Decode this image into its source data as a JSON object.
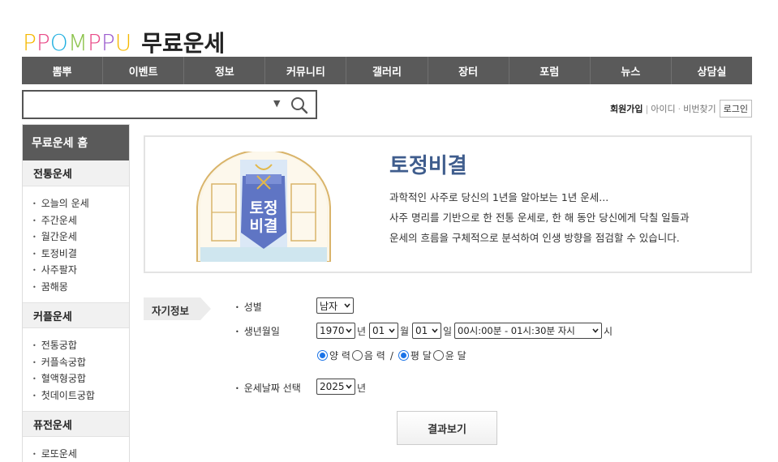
{
  "header": {
    "logo_letters": [
      "P",
      "P",
      "O",
      "M",
      "P",
      "P",
      "U"
    ],
    "logo_colors": [
      "#f5b800",
      "#e94c89",
      "#22b0e0",
      "#8bc34a",
      "#e94c89",
      "#9c5ccf",
      "#f5b800"
    ],
    "title": "무료운세"
  },
  "gnb": [
    "뽐뿌",
    "이벤트",
    "정보",
    "커뮤니티",
    "갤러리",
    "장터",
    "포럼",
    "뉴스",
    "상담실"
  ],
  "search": {
    "value": "",
    "arrow": "▼"
  },
  "member": {
    "join": "회원가입",
    "id": "아이디",
    "pw": "비번찾기",
    "login": "로그인"
  },
  "sidebar": {
    "home": "무료운세 홈",
    "categories": [
      {
        "title": "전통운세",
        "items": [
          "오늘의 운세",
          "주간운세",
          "월간운세",
          "토정비결",
          "사주팔자",
          "꿈해몽"
        ]
      },
      {
        "title": "커플운세",
        "items": [
          "전통궁합",
          "커플속궁합",
          "혈액형궁합",
          "첫데이트궁합"
        ]
      },
      {
        "title": "퓨전운세",
        "items": [
          "로또운세"
        ]
      }
    ]
  },
  "info": {
    "badge_line1": "토정",
    "badge_line2": "비결",
    "title": "토정비결",
    "desc": [
      "과학적인 사주로 당신의 1년을 알아보는 1년 운세...",
      "사주 명리를 기반으로 한 전통 운세로, 한 해 동안 당신에게 닥칠 일들과",
      "운세의 흐름을 구체적으로 분석하여 인생 방향을 점검할 수 있습니다."
    ]
  },
  "form": {
    "section_label": "자기정보",
    "gender_label": "성별",
    "gender_value": "남자",
    "birth_label": "생년월일",
    "year": "1970",
    "year_unit": "년",
    "month": "01",
    "month_unit": "월",
    "day": "01",
    "day_unit": "일",
    "time": "00시:00분 - 01시:30분 자시",
    "time_unit": "시",
    "calendar_solar": "양 력",
    "calendar_lunar": "음 력",
    "month_normal": "평 달",
    "month_leap": "윤 달",
    "target_label": "운세날짜 선택",
    "target_year": "2025",
    "target_unit": "년",
    "result_button": "결과보기"
  },
  "colors": {
    "nav_bg": "#5a5a5a",
    "title_blue": "#3f5d8d",
    "radio_blue": "#1a73e8"
  }
}
